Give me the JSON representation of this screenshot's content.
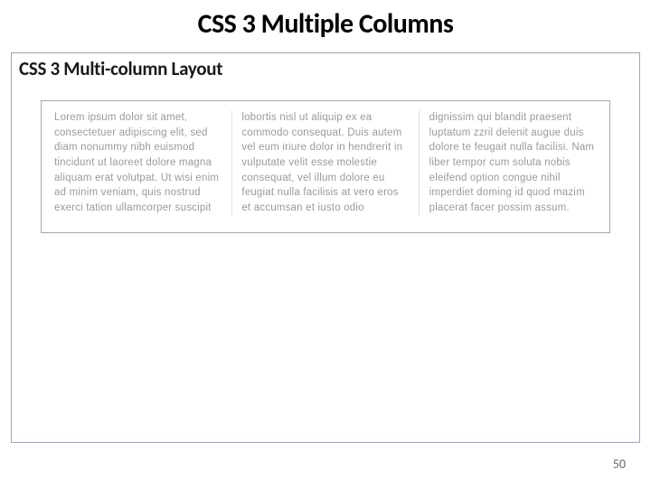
{
  "slide": {
    "title": "CSS 3 Multiple Columns",
    "subtitle": "CSS 3 Multi-column Layout",
    "body_text": "Lorem ipsum dolor sit amet, consectetuer adipiscing elit, sed diam nonummy nibh euismod tincidunt ut laoreet dolore magna aliquam erat volutpat. Ut wisi enim ad minim veniam, quis nostrud exerci tation ullamcorper suscipit lobortis nisl ut aliquip ex ea commodo consequat. Duis autem vel eum iriure dolor in hendrerit in vulputate velit esse molestie consequat, vel illum dolore eu feugiat nulla facilisis at vero eros et accumsan et iusto odio dignissim qui blandit praesent luptatum zzril delenit augue duis dolore te feugait nulla facilisi. Nam liber tempor cum soluta nobis eleifend option congue nihil imperdiet doming id quod mazim placerat facer possim assum.",
    "page_number": "50"
  }
}
